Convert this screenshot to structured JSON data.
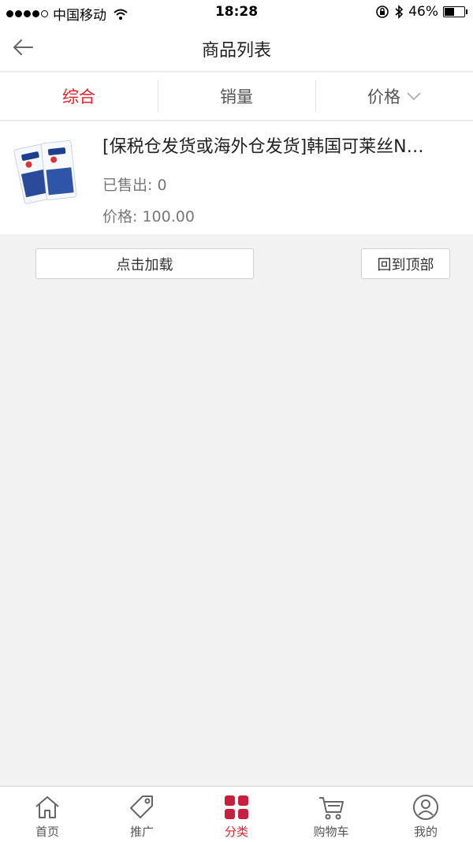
{
  "status": {
    "carrier": "中国移动",
    "time": "18:28",
    "battery": "46%",
    "battery_level": 0.46
  },
  "header": {
    "title": "商品列表"
  },
  "sort": {
    "tabs": [
      {
        "label": "综合"
      },
      {
        "label": "销量"
      },
      {
        "label": "价格"
      }
    ]
  },
  "products": [
    {
      "title": "[保税仓发货或海外仓发货]韩国可莱丝N…",
      "sold": "已售出: 0",
      "price": "价格: 100.00"
    }
  ],
  "actions": {
    "load_more": "点击加载",
    "back_to_top": "回到顶部"
  },
  "tabbar": {
    "items": [
      {
        "label": "首页",
        "icon": "home-icon"
      },
      {
        "label": "推广",
        "icon": "tag-icon"
      },
      {
        "label": "分类",
        "icon": "grid-icon"
      },
      {
        "label": "购物车",
        "icon": "cart-icon"
      },
      {
        "label": "我的",
        "icon": "user-icon"
      }
    ]
  },
  "colors": {
    "accent": "#e6212a",
    "tab_active": "#c8203c",
    "background": "#f2f2f2"
  }
}
